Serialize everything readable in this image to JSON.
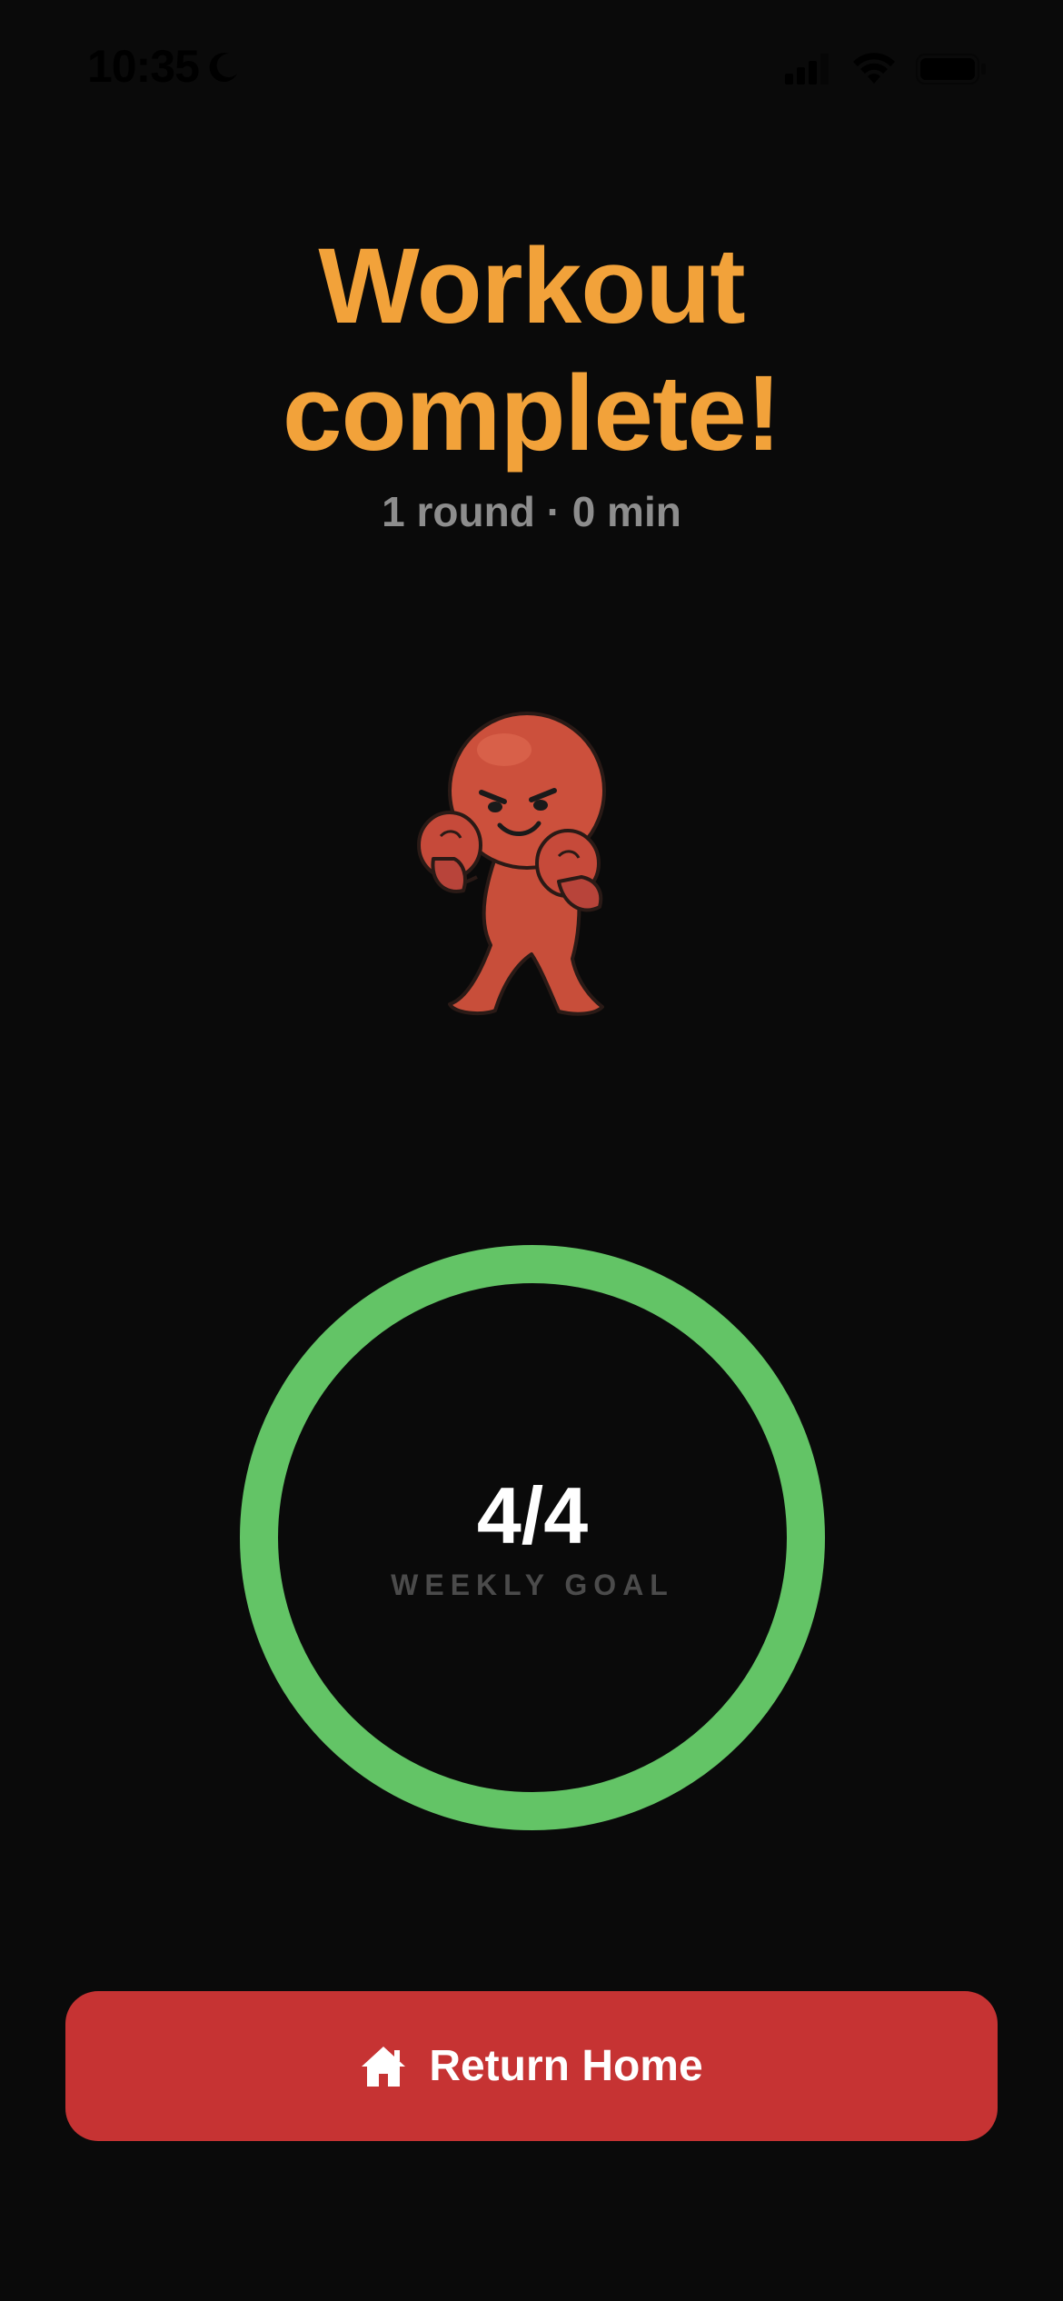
{
  "status_bar": {
    "time": "10:35",
    "focus_icon": "moon-icon",
    "signal_icon": "cellular-signal-icon",
    "wifi_icon": "wifi-icon",
    "battery_icon": "battery-icon"
  },
  "header": {
    "title_line1": "Workout",
    "title_line2": "complete!",
    "subtitle": "1 round · 0 min"
  },
  "mascot": {
    "icon": "boxer-mascot-icon"
  },
  "weekly_goal": {
    "value": "4/4",
    "label": "WEEKLY GOAL",
    "progress": 1.0
  },
  "actions": {
    "return_home_label": "Return Home",
    "return_home_icon": "home-icon"
  },
  "colors": {
    "background": "#0a0a0a",
    "title": "#f2a23a",
    "subtitle": "#8d8d8d",
    "ring": "#63c466",
    "button": "#c63333",
    "label": "#4b4b4b"
  }
}
